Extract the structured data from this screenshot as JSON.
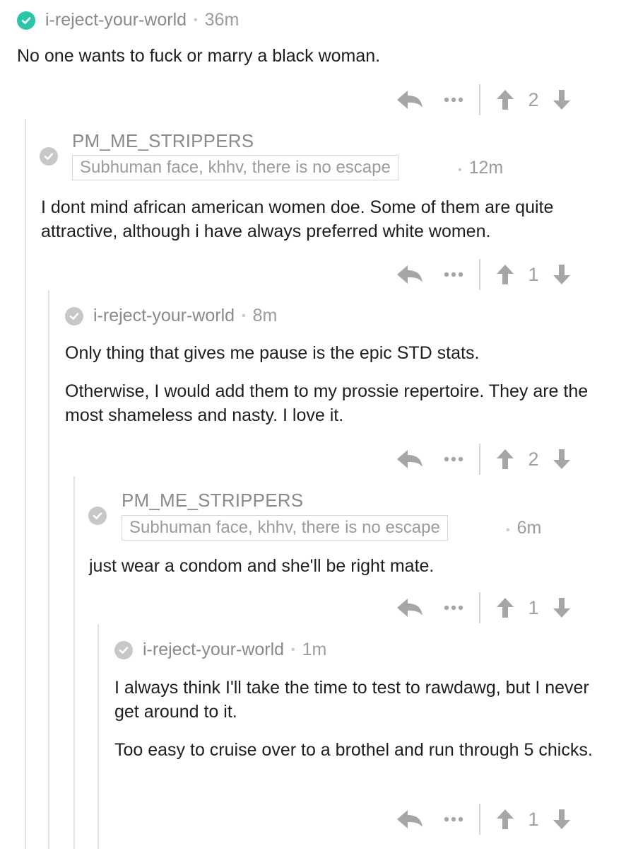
{
  "comments": [
    {
      "username": "i-reject-your-world",
      "time": "36m",
      "op": true,
      "paragraphs": [
        "No one wants to fuck or marry a black woman."
      ],
      "votes": "2"
    },
    {
      "username": "PM_ME_STRIPPERS",
      "flair": "Subhuman face, khhv, there is no escape",
      "time": "12m",
      "paragraphs": [
        "I dont mind african american women doe. Some of them are quite attractive, although i have always preferred white women."
      ],
      "votes": "1"
    },
    {
      "username": "i-reject-your-world",
      "time": "8m",
      "paragraphs": [
        "Only thing that gives me pause is the epic STD stats.",
        "Otherwise, I would add them to my prossie repertoire. They are the most shameless and nasty. I love it."
      ],
      "votes": "2"
    },
    {
      "username": "PM_ME_STRIPPERS",
      "flair": "Subhuman face, khhv, there is no escape",
      "time": "6m",
      "paragraphs": [
        "just wear a condom and she'll be right mate."
      ],
      "votes": "1"
    },
    {
      "username": "i-reject-your-world",
      "time": "1m",
      "paragraphs": [
        "I always think I'll take the time to test to rawdawg, but I never get around to it.",
        "Too easy to cruise over to a brothel and run through 5 chicks."
      ],
      "votes": "1"
    }
  ],
  "icons": {
    "verified": "check-circle-icon",
    "reply": "reply-arrow-icon",
    "more": "ellipsis-icon",
    "upvote": "arrow-up-icon",
    "downvote": "arrow-down-icon"
  },
  "colors": {
    "op_check": "#2bc5a8",
    "check": "#c7c7c7",
    "icon": "#a6a6a6",
    "thread_line": "#e3e3e3"
  }
}
